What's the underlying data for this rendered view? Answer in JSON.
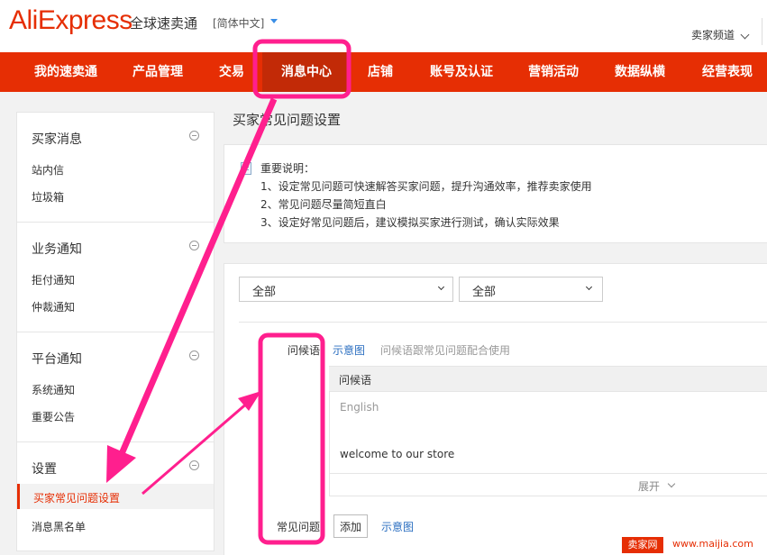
{
  "header": {
    "logo_text": "AliExpress",
    "logo_sub": "全球速卖通",
    "language": "[简体中文]",
    "buyer_channel": "卖家频道"
  },
  "nav": {
    "items": [
      {
        "label": "我的速卖通"
      },
      {
        "label": "产品管理"
      },
      {
        "label": "交易"
      },
      {
        "label": "消息中心",
        "active": true
      },
      {
        "label": "店铺"
      },
      {
        "label": "账号及认证"
      },
      {
        "label": "营销活动"
      },
      {
        "label": "数据纵横"
      },
      {
        "label": "经营表现"
      }
    ]
  },
  "sidebar": {
    "sections": [
      {
        "title": "买家消息",
        "items": [
          "站内信",
          "垃圾箱"
        ]
      },
      {
        "title": "业务通知",
        "items": [
          "拒付通知",
          "仲裁通知"
        ]
      },
      {
        "title": "平台通知",
        "items": [
          "系统通知",
          "重要公告"
        ]
      },
      {
        "title": "设置",
        "items": [
          "买家常见问题设置",
          "消息黑名单"
        ]
      }
    ]
  },
  "page": {
    "title": "买家常见问题设置"
  },
  "notice": {
    "title": "重要说明：",
    "lines": [
      "1、设定常见问题可快速解答买家问题，提升沟通效率，推荐卖家使用",
      "2、常见问题尽量简短直白",
      "3、设定好常见问题后，建议模拟买家进行测试，确认实际效果"
    ]
  },
  "filters": {
    "select1": "全部",
    "select2": "全部"
  },
  "greeting": {
    "label": "问候语",
    "example_link": "示意图",
    "hint": "问候语跟常见问题配合使用",
    "table_header": "问候语",
    "language": "English",
    "text": "welcome to our store",
    "expand": "展开"
  },
  "faq": {
    "label": "常见问题",
    "add_button": "添加",
    "example_link": "示意图"
  },
  "watermark": {
    "badge": "卖家网",
    "url": "www.maijia.com"
  },
  "colors": {
    "brand": "#e62e04",
    "annotation": "#ff1f8e",
    "link": "#2a6ec0"
  }
}
